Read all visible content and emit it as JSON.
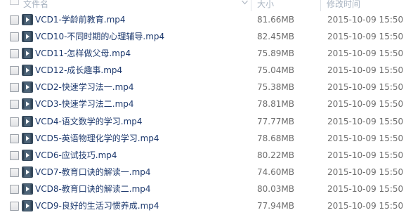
{
  "columns": {
    "name": "文件名",
    "size": "大小",
    "modified": "修改时间"
  },
  "files": [
    {
      "name": "VCD1-学龄前教育.mp4",
      "size": "81.66MB",
      "modified": "2015-10-09 15:50",
      "icon": "video-file-icon"
    },
    {
      "name": "VCD10-不同时期的心理辅导.mp4",
      "size": "82.45MB",
      "modified": "2015-10-09 15:50",
      "icon": "video-file-icon"
    },
    {
      "name": "VCD11-怎样做父母.mp4",
      "size": "75.89MB",
      "modified": "2015-10-09 15:50",
      "icon": "video-file-icon"
    },
    {
      "name": "VCD12-成长趣事.mp4",
      "size": "75.04MB",
      "modified": "2015-10-09 15:50",
      "icon": "video-file-icon"
    },
    {
      "name": "VCD2-快速学习法一.mp4",
      "size": "75.38MB",
      "modified": "2015-10-09 15:50",
      "icon": "video-file-icon"
    },
    {
      "name": "VCD3-快速学习法二.mp4",
      "size": "78.81MB",
      "modified": "2015-10-09 15:50",
      "icon": "video-file-icon"
    },
    {
      "name": "VCD4-语文数学的学习.mp4",
      "size": "77.77MB",
      "modified": "2015-10-09 15:50",
      "icon": "video-file-icon"
    },
    {
      "name": "VCD5-英语物理化学的学习.mp4",
      "size": "78.68MB",
      "modified": "2015-10-09 15:50",
      "icon": "video-file-icon"
    },
    {
      "name": "VCD6-应试技巧.mp4",
      "size": "80.22MB",
      "modified": "2015-10-09 15:50",
      "icon": "video-file-icon"
    },
    {
      "name": "VCD7-教育口诀的解读一.mp4",
      "size": "74.60MB",
      "modified": "2015-10-09 15:50",
      "icon": "video-file-icon"
    },
    {
      "name": "VCD8-教育口诀的解读二.mp4",
      "size": "80.03MB",
      "modified": "2015-10-09 15:50",
      "icon": "video-file-icon"
    },
    {
      "name": "VCD9-良好的生活习惯养成.mp4",
      "size": "77.94MB",
      "modified": "2015-10-09 15:50",
      "icon": "video-file-icon"
    }
  ],
  "colors": {
    "name_text": "#1e3a6e",
    "meta_text": "#6d6d6d",
    "header_text": "#a9b4c2",
    "icon_bg": "#4d6478"
  }
}
